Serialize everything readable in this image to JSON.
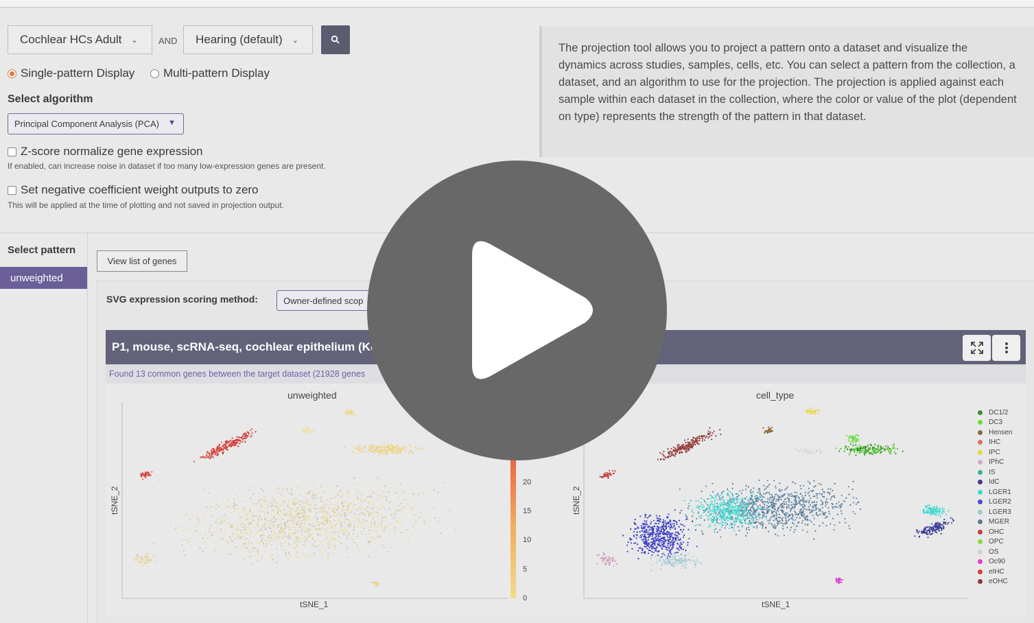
{
  "search": {
    "dataset_collection": "Cochlear HCs Adult",
    "and_label": "AND",
    "gene_collection": "Hearing (default)"
  },
  "display_mode": {
    "single_label": "Single-pattern Display",
    "multi_label": "Multi-pattern Display",
    "selected": "single"
  },
  "algorithm": {
    "heading": "Select algorithm",
    "selected": "Principal Component Analysis (PCA)"
  },
  "options": {
    "zscore_label": "Z-score normalize gene expression",
    "zscore_hint": "If enabled, can increase noise in dataset if too many low-expression genes are present.",
    "negzero_label": "Set negative coefficient weight outputs to zero",
    "negzero_hint": "This will be applied at the time of plotting and not saved in projection output."
  },
  "info_text": "The projection tool allows you to project a pattern onto a dataset and visualize the dynamics across studies, samples, cells, etc. You can select a pattern from the collection, a dataset, and an algorithm to use for the projection. The projection is applied against each sample within each dataset in the collection, where the color or value of the plot (dependent on type) represents the strength of the pattern in that dataset.",
  "pattern": {
    "heading": "Select pattern",
    "items": [
      "unweighted"
    ],
    "view_genes_label": "View list of genes"
  },
  "svg_scoring": {
    "label": "SVG expression scoring method:",
    "selected": "Owner-defined scop"
  },
  "dataset_card": {
    "title": "P1, mouse, scRNA-seq, cochlear epithelium (Ko",
    "found_text": "Found 13 common genes between the target dataset (21928 genes"
  },
  "plots": {
    "left": {
      "title": "unweighted",
      "xlabel": "tSNE_1",
      "ylabel": "tSNE_2"
    },
    "right": {
      "title": "cell_type",
      "xlabel": "tSNE_1",
      "ylabel": "tSNE_2"
    }
  },
  "colorbar": {
    "ticks": [
      "20",
      "15",
      "10",
      "5",
      "0"
    ],
    "colors": [
      "#e0453c",
      "#ec7a4a",
      "#f0b060",
      "#f2dc8a"
    ]
  },
  "legend": [
    {
      "label": "DC1/2",
      "color": "#3a8a3a"
    },
    {
      "label": "DC3",
      "color": "#6adc3a"
    },
    {
      "label": "Hensen",
      "color": "#8a6a3a"
    },
    {
      "label": "IHC",
      "color": "#e07060"
    },
    {
      "label": "IPC",
      "color": "#e6d838"
    },
    {
      "label": "IPhC",
      "color": "#d8a8c8"
    },
    {
      "label": "IS",
      "color": "#3ab0a0"
    },
    {
      "label": "IdC",
      "color": "#3a3a8a"
    },
    {
      "label": "LGER1",
      "color": "#40d8d0"
    },
    {
      "label": "LGER2",
      "color": "#4a4ad0"
    },
    {
      "label": "LGER3",
      "color": "#a0c8d0"
    },
    {
      "label": "MGER",
      "color": "#5a7a9a"
    },
    {
      "label": "OHC",
      "color": "#c04040"
    },
    {
      "label": "OPC",
      "color": "#8ad840"
    },
    {
      "label": "OS",
      "color": "#d0d0d0"
    },
    {
      "label": "Oc90",
      "color": "#e040d0"
    },
    {
      "label": "eIHC",
      "color": "#d04040"
    },
    {
      "label": "eOHC",
      "color": "#8a3a3a"
    }
  ]
}
